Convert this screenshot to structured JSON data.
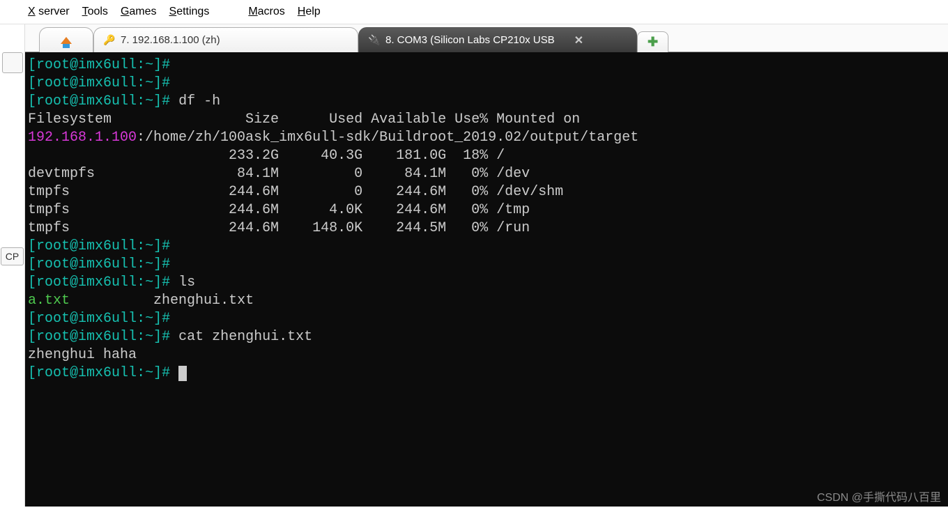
{
  "menubar": {
    "items": [
      "X server",
      "Tools",
      "Games",
      "Settings",
      "Macros",
      "Help"
    ],
    "accel_chars": [
      "X",
      "T",
      "G",
      "S",
      "M",
      "H"
    ]
  },
  "left_rail": {
    "tab_label": "CP"
  },
  "tabs": {
    "home": {
      "icon": "home-icon"
    },
    "ssh": {
      "icon": "key-icon",
      "label": "7. 192.168.1.100 (zh)"
    },
    "serial": {
      "icon": "plug-icon",
      "label": "8. COM3  (Silicon Labs CP210x USB",
      "close": "✕"
    },
    "new": {
      "icon": "plus-icon"
    }
  },
  "prompt": {
    "open": "[",
    "user": "root",
    "at": "@",
    "host": "imx6ull",
    "sep": ":",
    "path": "~",
    "close": "]#"
  },
  "commands": {
    "df": "df -h",
    "ls": "ls",
    "cat": "cat zhenghui.txt"
  },
  "df_header": "Filesystem                Size      Used Available Use% Mounted on",
  "nfs_host": "192.168.1.100",
  "nfs_path": ":/home/zh/100ask_imx6ull-sdk/Buildroot_2019.02/output/target",
  "df_rows": [
    "                        233.2G     40.3G    181.0G  18% /",
    "devtmpfs                 84.1M         0     84.1M   0% /dev",
    "tmpfs                   244.6M         0    244.6M   0% /dev/shm",
    "tmpfs                   244.6M      4.0K    244.6M   0% /tmp",
    "tmpfs                   244.6M    148.0K    244.5M   0% /run"
  ],
  "ls_output": {
    "file1": "a.txt",
    "spacer": "          ",
    "file2": "zhenghui.txt"
  },
  "cat_output": "zhenghui haha",
  "watermark": "CSDN @手撕代码八百里"
}
